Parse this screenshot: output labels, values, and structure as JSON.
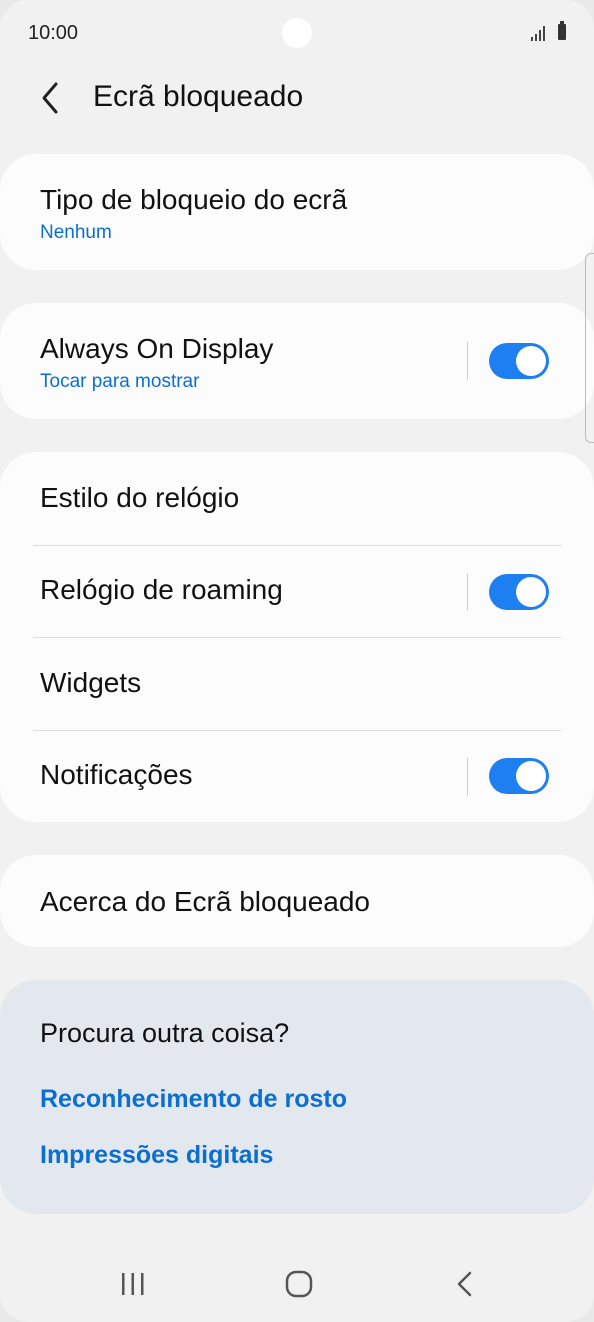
{
  "status_bar": {
    "time": "10:00"
  },
  "header": {
    "title": "Ecrã bloqueado"
  },
  "lock_type": {
    "title": "Tipo de bloqueio do ecrã",
    "value": "Nenhum"
  },
  "aod": {
    "title": "Always On Display",
    "subtitle": "Tocar para mostrar",
    "enabled": true
  },
  "settings_group": {
    "clock_style": "Estilo do relógio",
    "roaming_clock": "Relógio de roaming",
    "widgets": "Widgets",
    "notifications": "Notificações"
  },
  "about": {
    "title": "Acerca do Ecrã bloqueado"
  },
  "suggestions": {
    "title": "Procura outra coisa?",
    "links": [
      "Reconhecimento de rosto",
      "Impressões digitais"
    ]
  },
  "colors": {
    "accent": "#1e7ff0",
    "link": "#0b6fd0",
    "background": "#f1f1f1",
    "card": "#fcfcfc",
    "suggest_bg": "#e3e8ef"
  }
}
